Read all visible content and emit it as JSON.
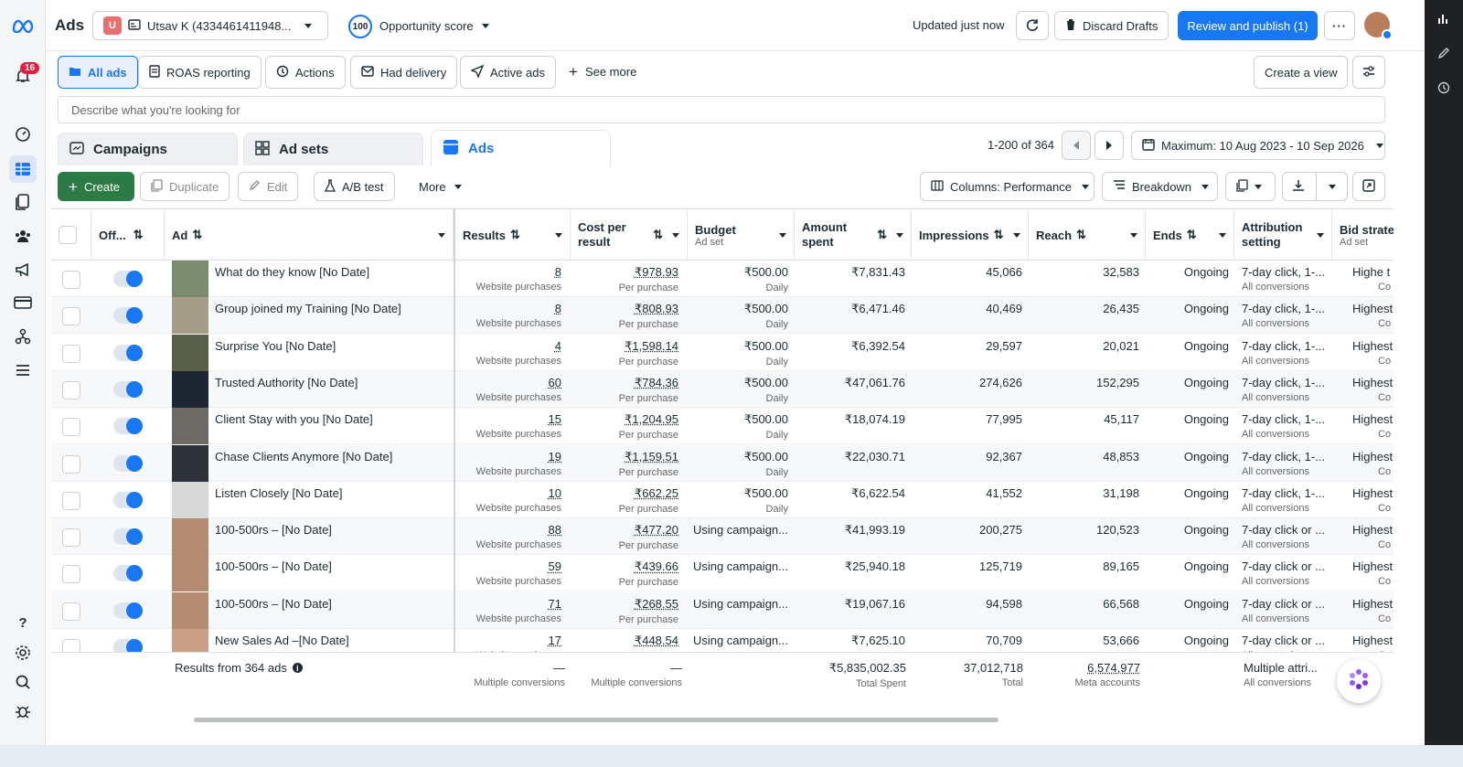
{
  "topbar": {
    "title": "Ads",
    "account_initial": "U",
    "account_name": "Utsav K (4334461411948...",
    "opportunity_value": "100",
    "opportunity_label": "Opportunity score",
    "updated": "Updated just now",
    "discard": "Discard Drafts",
    "review": "Review and publish (1)"
  },
  "nav": {
    "notifications": "16"
  },
  "views": {
    "items": [
      "All ads",
      "ROAS reporting",
      "Actions",
      "Had delivery",
      "Active ads"
    ],
    "see_more": "See more",
    "create_view": "Create a view"
  },
  "search": {
    "placeholder": "Describe what you're looking for"
  },
  "level_tabs": [
    "Campaigns",
    "Ad sets",
    "Ads"
  ],
  "pagination": {
    "range": "1-200 of 364",
    "date_range": "Maximum: 10 Aug 2023 - 10 Sep 2026"
  },
  "toolbar": {
    "create": "Create",
    "duplicate": "Duplicate",
    "edit": "Edit",
    "ab_test": "A/B test",
    "more": "More",
    "columns": "Columns: Performance",
    "breakdown": "Breakdown"
  },
  "columns": {
    "off": "Off...",
    "ad": "Ad",
    "results": "Results",
    "cost": "Cost per result",
    "budget": "Budget",
    "budget_sub": "Ad set",
    "amount": "Amount spent",
    "impressions": "Impressions",
    "reach": "Reach",
    "ends": "Ends",
    "attribution": "Attribution setting",
    "bid": "Bid strate",
    "bid_sub": "Ad set"
  },
  "rows": [
    {
      "name": "What do they know [No Date]",
      "results": "8",
      "cost": "₹978.93",
      "budget": "₹500.00",
      "budget_sub": "Daily",
      "amount": "₹7,831.43",
      "impressions": "45,066",
      "reach": "32,583",
      "ends": "Ongoing",
      "attribution": "7-day click, 1-...",
      "bid": "Highe t"
    },
    {
      "name": "Group joined my Training [No Date]",
      "results": "8",
      "cost": "₹808.93",
      "budget": "₹500.00",
      "budget_sub": "Daily",
      "amount": "₹6,471.46",
      "impressions": "40,469",
      "reach": "26,435",
      "ends": "Ongoing",
      "attribution": "7-day click, 1-...",
      "bid": "Highest"
    },
    {
      "name": "Surprise You [No Date]",
      "results": "4",
      "cost": "₹1,598.14",
      "budget": "₹500.00",
      "budget_sub": "Daily",
      "amount": "₹6,392.54",
      "impressions": "29,597",
      "reach": "20,021",
      "ends": "Ongoing",
      "attribution": "7-day click, 1-...",
      "bid": "Highest"
    },
    {
      "name": "Trusted Authority [No Date]",
      "results": "60",
      "cost": "₹784.36",
      "budget": "₹500.00",
      "budget_sub": "Daily",
      "amount": "₹47,061.76",
      "impressions": "274,626",
      "reach": "152,295",
      "ends": "Ongoing",
      "attribution": "7-day click, 1-...",
      "bid": "Highest"
    },
    {
      "name": "Client Stay with you [No Date]",
      "results": "15",
      "cost": "₹1,204.95",
      "budget": "₹500.00",
      "budget_sub": "Daily",
      "amount": "₹18,074.19",
      "impressions": "77,995",
      "reach": "45,117",
      "ends": "Ongoing",
      "attribution": "7-day click, 1-...",
      "bid": "Highest"
    },
    {
      "name": "Chase Clients Anymore [No Date]",
      "results": "19",
      "cost": "₹1,159.51",
      "budget": "₹500.00",
      "budget_sub": "Daily",
      "amount": "₹22,030.71",
      "impressions": "92,367",
      "reach": "48,853",
      "ends": "Ongoing",
      "attribution": "7-day click, 1-...",
      "bid": "Highest"
    },
    {
      "name": "Listen Closely [No Date]",
      "results": "10",
      "cost": "₹662.25",
      "budget": "₹500.00",
      "budget_sub": "Daily",
      "amount": "₹6,622.54",
      "impressions": "41,552",
      "reach": "31,198",
      "ends": "Ongoing",
      "attribution": "7-day click, 1-...",
      "bid": "Highest"
    },
    {
      "name": "100-500rs – [No Date]",
      "results": "88",
      "cost": "₹477.20",
      "budget": "Using campaign...",
      "budget_sub": "",
      "amount": "₹41,993.19",
      "impressions": "200,275",
      "reach": "120,523",
      "ends": "Ongoing",
      "attribution": "7-day click or ...",
      "bid": "Highest"
    },
    {
      "name": "100-500rs – [No Date]",
      "results": "59",
      "cost": "₹439.66",
      "budget": "Using campaign...",
      "budget_sub": "",
      "amount": "₹25,940.18",
      "impressions": "125,719",
      "reach": "89,165",
      "ends": "Ongoing",
      "attribution": "7-day click or ...",
      "bid": "Highest"
    },
    {
      "name": "100-500rs – [No Date]",
      "results": "71",
      "cost": "₹268.55",
      "budget": "Using campaign...",
      "budget_sub": "",
      "amount": "₹19,067.16",
      "impressions": "94,598",
      "reach": "66,568",
      "ends": "Ongoing",
      "attribution": "7-day click or ...",
      "bid": "Highest"
    },
    {
      "name": "New Sales Ad –[No Date]",
      "results": "17",
      "cost": "₹448.54",
      "budget": "Using campaign...",
      "budget_sub": "",
      "amount": "₹7,625.10",
      "impressions": "70,709",
      "reach": "53,666",
      "ends": "Ongoing",
      "attribution": "7-day click or ...",
      "bid": "Highest"
    }
  ],
  "row_labels": {
    "results_sub": "Website purchases",
    "cost_sub": "Per purchase",
    "attribution_sub": "All conversions",
    "bid_sub": "Co"
  },
  "footer": {
    "label": "Results from 364 ads",
    "results": "—",
    "results_sub": "Multiple conversions",
    "cost": "—",
    "cost_sub": "Multiple conversions",
    "amount": "₹5,835,002.35",
    "amount_sub": "Total Spent",
    "impressions": "37,012,718",
    "impressions_sub": "Total",
    "reach": "6,574,977",
    "reach_sub": "Meta accounts",
    "attribution": "Multiple attri...",
    "attribution_sub": "All conversions"
  },
  "colors": {
    "accent": "#1877f2",
    "create": "#2c7a44",
    "badge": "#e41e3f"
  }
}
